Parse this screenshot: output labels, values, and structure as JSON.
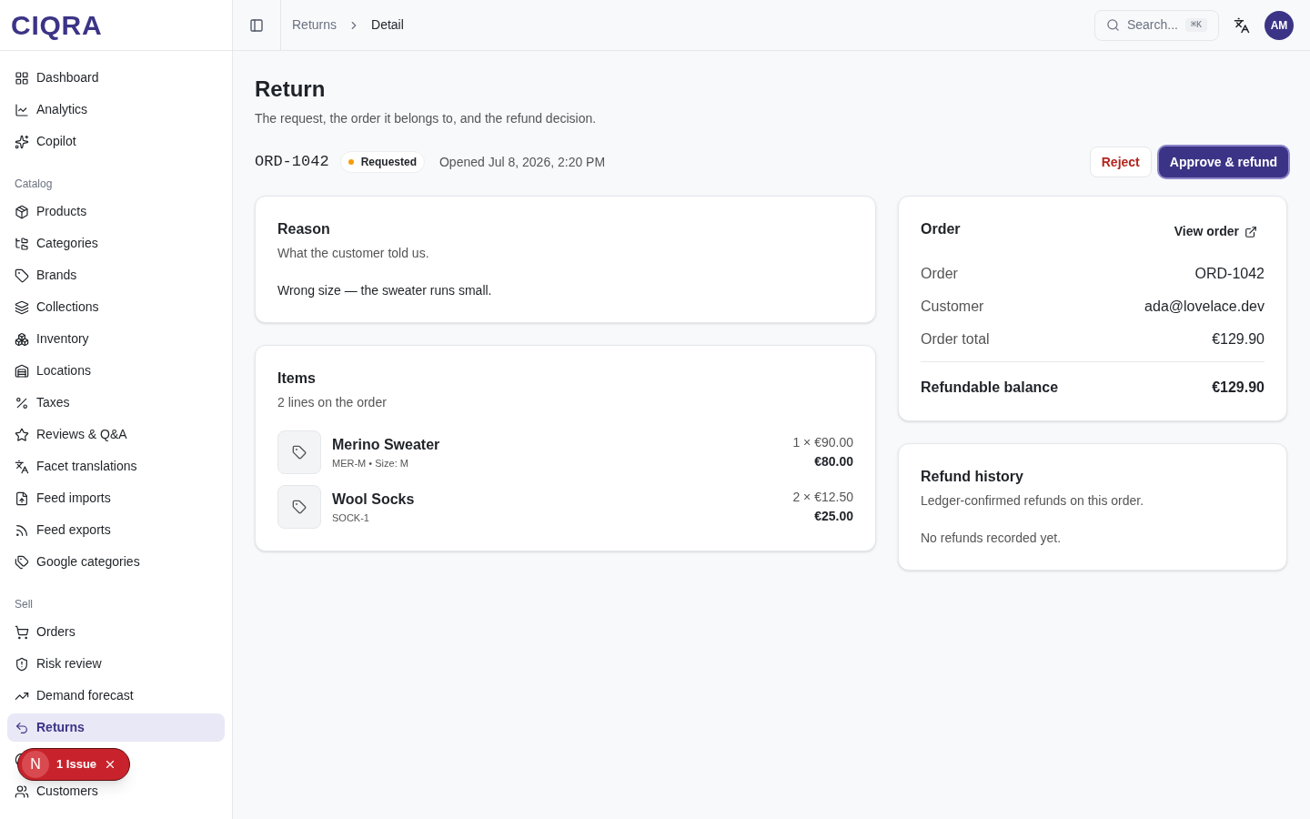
{
  "brand": "CIQRA",
  "sidebar": {
    "sections": [
      {
        "items": [
          {
            "label": "Dashboard",
            "selected": false
          },
          {
            "label": "Analytics",
            "selected": false
          },
          {
            "label": "Copilot",
            "selected": false
          }
        ]
      },
      {
        "title": "Catalog",
        "items": [
          {
            "label": "Products",
            "selected": false
          },
          {
            "label": "Categories",
            "selected": false
          },
          {
            "label": "Brands",
            "selected": false
          },
          {
            "label": "Collections",
            "selected": false
          },
          {
            "label": "Inventory",
            "selected": false
          },
          {
            "label": "Locations",
            "selected": false
          },
          {
            "label": "Taxes",
            "selected": false
          },
          {
            "label": "Reviews & Q&A",
            "selected": false
          },
          {
            "label": "Facet translations",
            "selected": false
          },
          {
            "label": "Feed imports",
            "selected": false
          },
          {
            "label": "Feed exports",
            "selected": false
          },
          {
            "label": "Google categories",
            "selected": false
          }
        ]
      },
      {
        "title": "Sell",
        "items": [
          {
            "label": "Orders",
            "selected": false
          },
          {
            "label": "Risk review",
            "selected": false
          },
          {
            "label": "Demand forecast",
            "selected": false
          },
          {
            "label": "Returns",
            "selected": true
          },
          {
            "selected": false
          },
          {
            "label": "Customers",
            "selected": false
          }
        ]
      }
    ]
  },
  "toast": {
    "letter": "N",
    "text": "1 Issue"
  },
  "breadcrumb": [
    "Returns",
    "Detail"
  ],
  "search": {
    "placeholder": "Search...",
    "shortcut": "⌘K"
  },
  "avatar": "AM",
  "page": {
    "title": "Return",
    "subtitle": "The request, the order it belongs to, and the refund decision.",
    "order_id": "ORD-1042",
    "status": {
      "label": "Requested",
      "color": "#f59e0b"
    },
    "opened": "Opened Jul 8, 2026, 2:20 PM",
    "actions": [
      {
        "label": "Reject",
        "kind": "secondary"
      },
      {
        "label": "Approve & refund",
        "kind": "primary"
      }
    ]
  },
  "reason": {
    "title": "Reason",
    "subtitle": "What the customer told us.",
    "text": "Wrong size — the sweater runs small."
  },
  "items": {
    "title": "Items",
    "subtitle": "2 lines on the order",
    "lines": [
      {
        "name": "Merino Sweater",
        "meta": "MER-M • Size: M",
        "unit": "1 × €90.00",
        "total": "€80.00"
      },
      {
        "name": "Wool Socks",
        "meta": "SOCK-1",
        "unit": "2 × €12.50",
        "total": "€25.00"
      }
    ]
  },
  "order": {
    "title": "Order",
    "link": "View order",
    "rows": [
      {
        "label": "Order",
        "value": "ORD-1042"
      },
      {
        "label": "Customer",
        "value": "ada@lovelace.dev"
      },
      {
        "label": "Order total",
        "value": "€129.90"
      }
    ],
    "balance": {
      "label": "Refundable balance",
      "value": "€129.90"
    }
  },
  "refunds": {
    "title": "Refund history",
    "subtitle": "Ledger-confirmed refunds on this order.",
    "empty": "No refunds recorded yet."
  }
}
